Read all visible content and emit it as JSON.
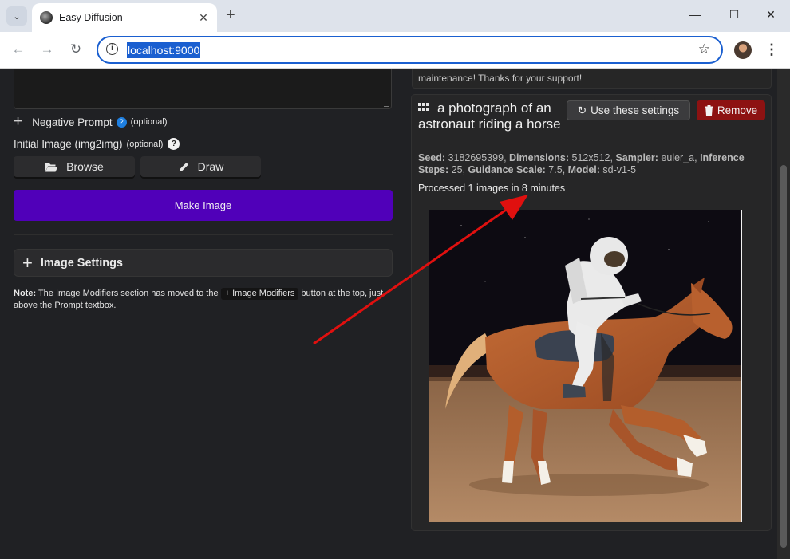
{
  "browser": {
    "tab_title": "Easy Diffusion",
    "url": "localhost:9000",
    "new_tab": "+",
    "tab_close": "✕",
    "minimize": "—",
    "maximize": "☐",
    "close": "✕"
  },
  "left": {
    "negative_prompt_label": "Negative Prompt",
    "negative_prompt_optional": "(optional)",
    "initial_image_label": "Initial Image (img2img)",
    "initial_image_optional": "(optional)",
    "browse_label": "Browse",
    "draw_label": "Draw",
    "make_image_label": "Make Image",
    "image_settings_label": "Image Settings",
    "note_prefix": "Note:",
    "note_text_1": " The Image Modifiers section has moved to the ",
    "note_chip": "+ Image Modifiers",
    "note_text_2": " button at the top, just above the Prompt textbox."
  },
  "right": {
    "message_tail": "maintenance! Thanks for your support!",
    "task_title": "a photograph of an astronaut riding a horse",
    "use_settings_label": "Use these settings",
    "remove_label": "Remove",
    "meta": {
      "seed_label": "Seed:",
      "seed": "3182695399",
      "dimensions_label": "Dimensions:",
      "dimensions": "512x512",
      "sampler_label": "Sampler:",
      "sampler": "euler_a",
      "steps_label": "Inference Steps:",
      "steps": "25",
      "guidance_label": "Guidance Scale:",
      "guidance": "7.5",
      "model_label": "Model:",
      "model": "sd-v1-5"
    },
    "processed_text": "Processed 1 images in 8 minutes"
  },
  "colors": {
    "accent_purple": "#5000b9",
    "remove_red": "#8d1212",
    "annotation_arrow": "#e0100f"
  }
}
